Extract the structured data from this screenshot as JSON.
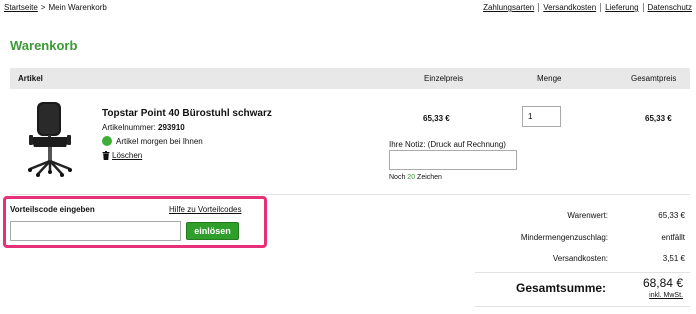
{
  "breadcrumb": {
    "home": "Startseite",
    "separator": ">",
    "current": "Mein Warenkorb"
  },
  "top_links": [
    "Zahlungsarten",
    "Versandkosten",
    "Lieferung",
    "Datenschutz"
  ],
  "page_title": "Warenkorb",
  "table_header": {
    "article": "Artikel",
    "unit_price": "Einzelpreis",
    "quantity": "Menge",
    "total_price": "Gesamtpreis"
  },
  "product": {
    "name": "Topstar Point 40 Bürostuhl schwarz",
    "article_number_label": "Artikelnummer:",
    "article_number": "293910",
    "availability": "Artikel morgen bei Ihnen",
    "delete": "Löschen",
    "unit_price": "65,33 €",
    "quantity": "1",
    "total_price": "65,33 €",
    "note_label": "Ihre Notiz: (Druck auf Rechnung)",
    "note_value": "",
    "remaining_prefix": "Noch",
    "remaining_count": "20",
    "remaining_suffix": "Zeichen"
  },
  "voucher": {
    "label": "Vorteilscode eingeben",
    "help_link": "Hilfe zu Vorteilcodes",
    "value": "",
    "button": "einlösen"
  },
  "summary": {
    "goods_value_label": "Warenwert:",
    "goods_value": "65,33 €",
    "min_quantity_label": "Mindermengenzuschlag:",
    "min_quantity": "entfällt",
    "shipping_label": "Versandkosten:",
    "shipping": "3,51 €",
    "total_label": "Gesamtsumme:",
    "total": "68,84 €",
    "tax_note": "inkl. MwSt."
  },
  "colors": {
    "accent_green": "#3a9a34",
    "button_green": "#2f9e2a",
    "highlight_pink": "#e7307a",
    "header_gray": "#e8e8e8"
  },
  "icons": {
    "availability": "green-dot-icon",
    "delete": "trash-icon",
    "product_image": "office-chair-icon"
  }
}
